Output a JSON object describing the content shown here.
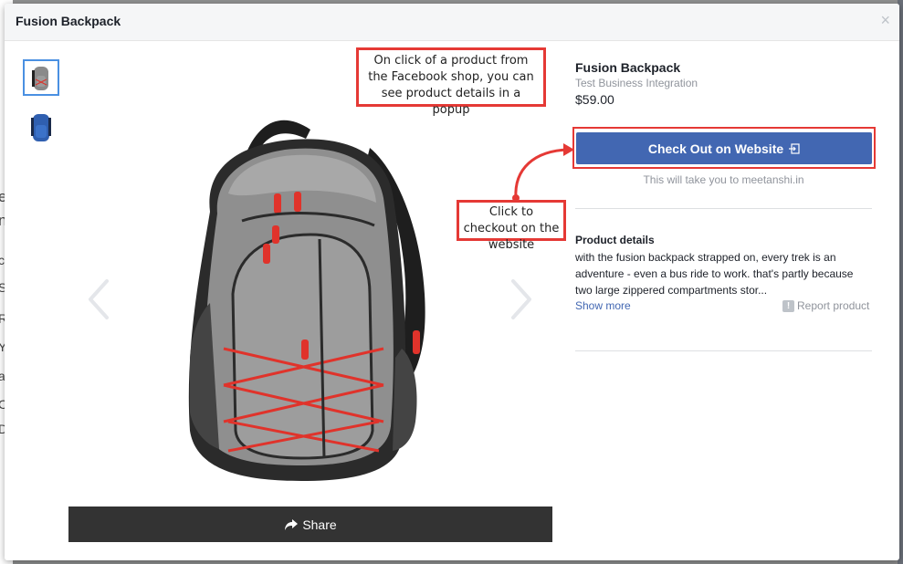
{
  "background": {
    "stubs": [
      "e",
      "n",
      "c",
      "S",
      "R",
      "Y",
      "a",
      "C",
      "D"
    ]
  },
  "modal": {
    "title": "Fusion Backpack",
    "close_glyph": "×"
  },
  "product": {
    "name": "Fusion Backpack",
    "store": "Test Business Integration",
    "price": "$59.00",
    "checkout_label": "Check Out on Website",
    "checkout_note": "This will take you to meetanshi.in",
    "details_heading": "Product details",
    "details_text": "with the fusion backpack strapped on, every trek is an adventure - even a bus ride to work. that's partly because two large zippered compartments stor...",
    "show_more": "Show more",
    "report": "Report product"
  },
  "gallery": {
    "share_label": "Share"
  },
  "annotations": {
    "popup_note": "On click of a product from the Facebook shop, you can see product details in a popup",
    "checkout_note": "Click to checkout on the website"
  },
  "colors": {
    "accent": "#4267b2",
    "annotation": "#e53935",
    "share_bar": "#333333"
  }
}
